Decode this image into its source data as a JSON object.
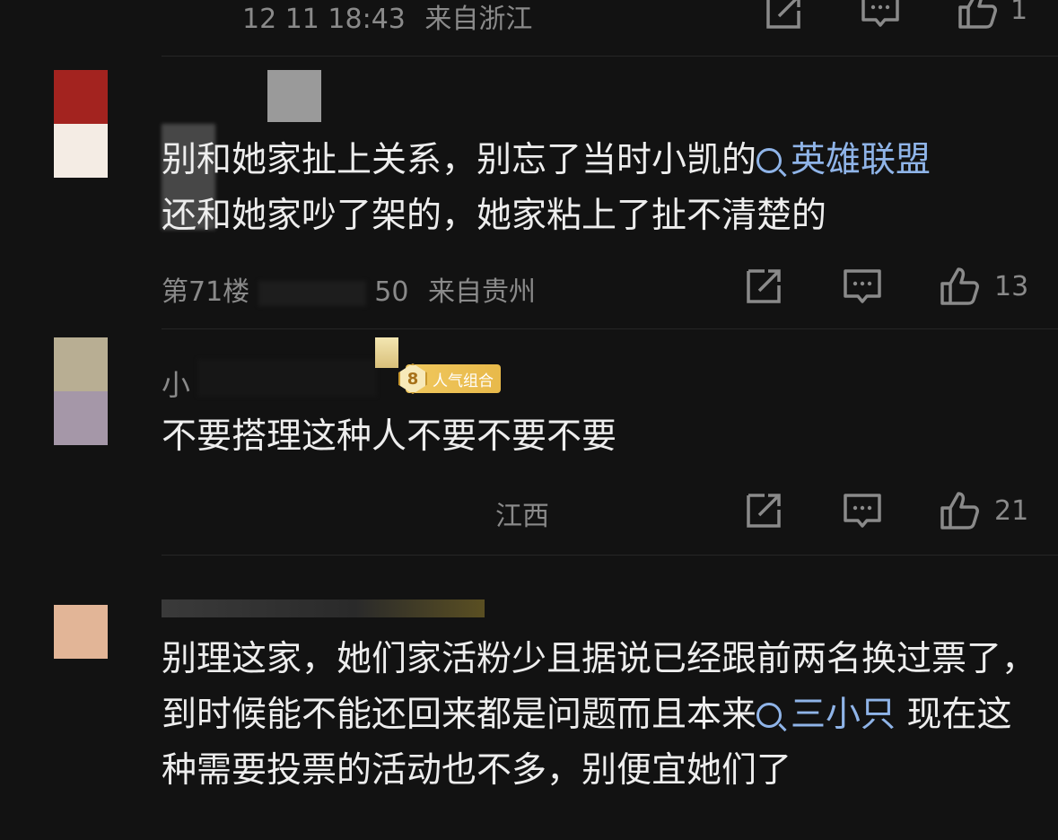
{
  "comments": [
    {
      "id": "c1",
      "floor_time": "12 11 18:43",
      "location": "来自浙江",
      "likes": "1"
    },
    {
      "id": "c2",
      "floor_time": "第71楼",
      "time_tail": "50",
      "location": "来自贵州",
      "text_parts": [
        "别和她家扯上关系，别忘了当时小凯的",
        "英雄联盟",
        "还和她家吵了架的，她家粘上了扯不清楚的"
      ],
      "likes": "13",
      "avatar_colors": [
        "#a3231f",
        "#f4ece4"
      ]
    },
    {
      "id": "c3",
      "username": "小",
      "badge_level": "8",
      "badge_label": "人气组合",
      "location": "江西",
      "text": "不要搭理这种人不要不要不要",
      "likes": "21",
      "avatar_colors": [
        "#b8ae93",
        "#a597a8"
      ]
    },
    {
      "id": "c4",
      "text_parts": [
        "别理这家，她们家活粉少且据说已经跟前两名换过票了，到时候能不能还回来都是问题而且本来",
        "三小只",
        "现在这种需要投票的活动也不多，别便宜她们了"
      ],
      "avatar_colors": [
        "#e2b597",
        "#e2b597"
      ]
    }
  ],
  "icons": {
    "repost": "repost-icon",
    "comment": "comment-icon",
    "like": "thumbs-up-icon",
    "search": "search-icon"
  },
  "colors": {
    "background": "#121212",
    "topic_link": "#8fb4e8",
    "meta_text": "#8a8a8a",
    "badge": "#f0c85e"
  }
}
